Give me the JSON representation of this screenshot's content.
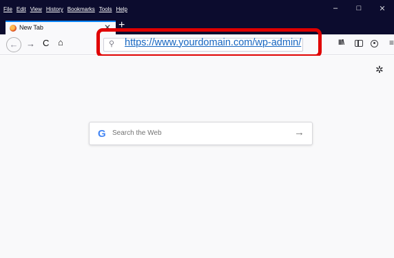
{
  "menu": [
    {
      "label": "File"
    },
    {
      "label": "Edit"
    },
    {
      "label": "View"
    },
    {
      "label": "History"
    },
    {
      "label": "Bookmarks"
    },
    {
      "label": "Tools"
    },
    {
      "label": "Help"
    }
  ],
  "window_controls": {
    "minimize": "–",
    "maximize": "□",
    "close": "✕"
  },
  "tab": {
    "title": "New Tab",
    "close": "✕"
  },
  "new_tab": "+",
  "nav": {
    "back": "←",
    "forward": "→",
    "reload": "C",
    "home": "⌂"
  },
  "urlbar": {
    "search_icon": "⚲",
    "url": "https://www.yourdomain.com/wp-admin/"
  },
  "toolbar": {
    "library": "III\\",
    "menu": "≡"
  },
  "content": {
    "settings": "✲",
    "search_placeholder": "Search the Web",
    "google_letter": "G",
    "search_arrow": "→"
  },
  "colors": {
    "highlight": "#e00000",
    "titlebar": "#0c0c2e",
    "link": "#1565c0",
    "tab_accent": "#0a84ff"
  },
  "icons": [
    "firefox-icon",
    "search-icon",
    "sidebar-icon",
    "account-icon",
    "gear-icon",
    "google-icon",
    "arrow-right-icon"
  ]
}
